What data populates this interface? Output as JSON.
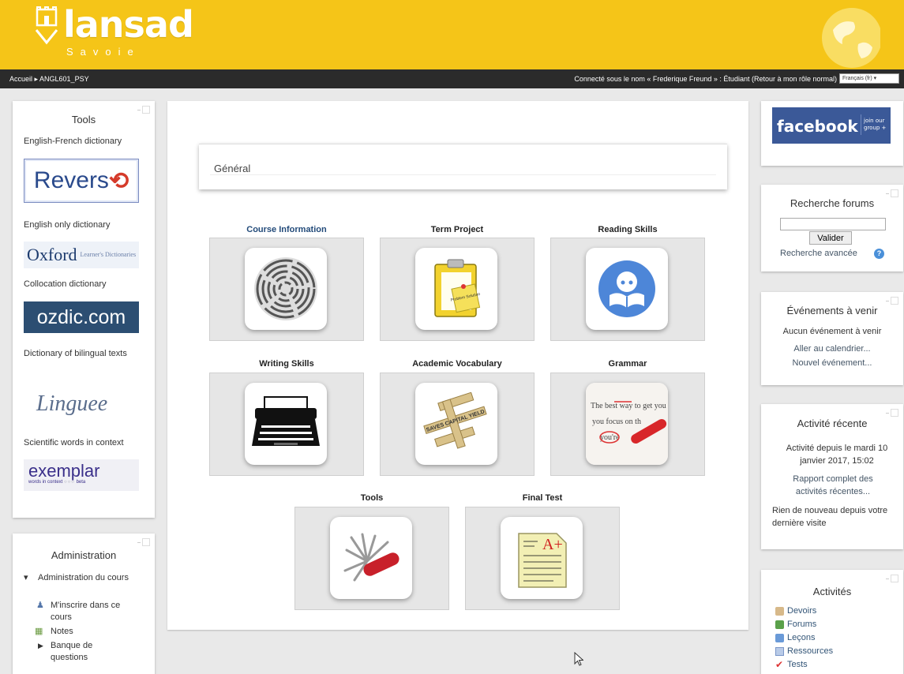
{
  "header": {
    "logo_text": "lansad",
    "logo_sub": "Savoie"
  },
  "navbar": {
    "breadcrumb": "Accueil ▸ ANGL601_PSY",
    "login_info": "Connecté sous le nom « Frederique Freund » : Étudiant (Retour à mon rôle normal)",
    "language": "Français (fr)"
  },
  "tools_block": {
    "title": "Tools",
    "label_1": "English-French dictionary",
    "reverso_logo": "Revers",
    "label_2": "English only dictionary",
    "oxford_logo": "Oxford",
    "oxford_sub": "Learner's Dictionaries",
    "label_3": "Collocation dictionary",
    "ozdic_logo": "ozdic.com",
    "label_4": "Dictionary of bilingual texts",
    "linguee_logo": "Linguee",
    "label_5": "Scientific words in context",
    "exemplar_logo": "exemplar",
    "exemplar_sub": "words in context",
    "exemplar_beta": "beta"
  },
  "admin_block": {
    "title": "Administration",
    "items": [
      "Administration du cours",
      "M'inscrire dans ce cours",
      "Notes",
      "Banque de questions"
    ]
  },
  "course": {
    "section_title": "Général",
    "tiles": [
      {
        "title": "Course Information",
        "icon": "maze-icon"
      },
      {
        "title": "Term Project",
        "icon": "clipboard-icon"
      },
      {
        "title": "Reading Skills",
        "icon": "reader-icon"
      },
      {
        "title": "Writing Skills",
        "icon": "typewriter-icon"
      },
      {
        "title": "Academic Vocabulary",
        "icon": "scrabble-icon"
      },
      {
        "title": "Grammar",
        "icon": "grammar-correction-icon"
      },
      {
        "title": "Tools",
        "icon": "swiss-knife-icon"
      },
      {
        "title": "Final Test",
        "icon": "test-paper-icon"
      }
    ],
    "clipboard_note": "Problem Solution",
    "scrabble_words": "SAVES CAPITAL YIELD",
    "grammar_text": "The best way to get you focus on the you're",
    "test_grade": "A+"
  },
  "facebook": {
    "label": "facebook",
    "join": "join our group +"
  },
  "search_forums": {
    "title": "Recherche forums",
    "button": "Valider",
    "advanced": "Recherche avancée"
  },
  "events": {
    "title": "Événements à venir",
    "none": "Aucun événement à venir",
    "calendar": "Aller au calendrier...",
    "new_event": "Nouvel événement..."
  },
  "recent": {
    "title": "Activité récente",
    "since": "Activité depuis le mardi 10 janvier 2017, 15:02",
    "full_report": "Rapport complet des activités récentes...",
    "nothing_new": "Rien de nouveau depuis votre dernière visite"
  },
  "activities": {
    "title": "Activités",
    "items": [
      "Devoirs",
      "Forums",
      "Leçons",
      "Ressources",
      "Tests"
    ]
  },
  "colors": {
    "header_yellow": "#f5c518",
    "navbar_dark": "#2b2b2b",
    "facebook_blue": "#3b5998",
    "ozdic_blue": "#2c4e72"
  }
}
